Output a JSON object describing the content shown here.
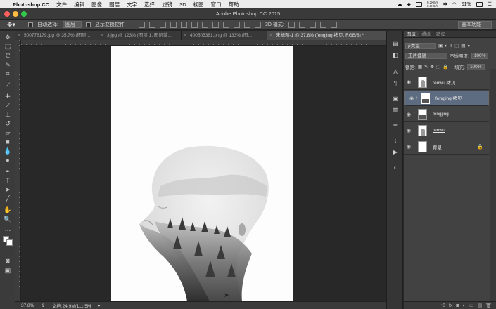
{
  "menubar": {
    "app_name": "Photoshop CC",
    "menus": [
      "文件",
      "编辑",
      "图像",
      "图层",
      "文字",
      "选择",
      "滤镜",
      "3D",
      "视图",
      "窗口",
      "帮助"
    ],
    "net_up": "0.2KB/s",
    "net_down": "0.0KB/s",
    "battery": "61%"
  },
  "window": {
    "title": "Adobe Photoshop CC 2015"
  },
  "options_bar": {
    "auto_select_label": "自动选择:",
    "auto_select_value": "图层",
    "show_transform_label": "显示变换控件",
    "mode_3d_label": "3D 模式:",
    "workspace": "基本功能"
  },
  "tabs": [
    {
      "label": "500778179.jpg @ 35.7% (图层..."
    },
    {
      "label": "3.jpg @ 123% (图层 1, 图层蒙..."
    },
    {
      "label": "400505381.png @ 133% (图..."
    },
    {
      "label": "未标题-1 @ 37.8% (fengjing 拷贝, RGB/8) *"
    }
  ],
  "status_bar": {
    "zoom": "37.8%",
    "doc_info": "文档:24.9M/111.5M"
  },
  "layers_panel": {
    "tabs": [
      "图层",
      "通道",
      "路径"
    ],
    "filter_kind": "ρ类型",
    "blend_mode": "正片叠底",
    "opacity_label": "不透明度:",
    "opacity_value": "100%",
    "lock_label": "锁定:",
    "fill_label": "填充:",
    "fill_value": "100%",
    "layers": [
      {
        "name": "renwu 拷贝",
        "selected": false,
        "locked": false
      },
      {
        "name": "fengjing 拷贝",
        "selected": true,
        "locked": false
      },
      {
        "name": "fengjing",
        "selected": false,
        "locked": false
      },
      {
        "name": "renwu",
        "selected": false,
        "locked": false
      },
      {
        "name": "背景",
        "selected": false,
        "locked": true
      }
    ]
  },
  "colors": {
    "selected_layer": "#5e6c82",
    "ui_dark": "#282828",
    "panel": "#424242"
  }
}
